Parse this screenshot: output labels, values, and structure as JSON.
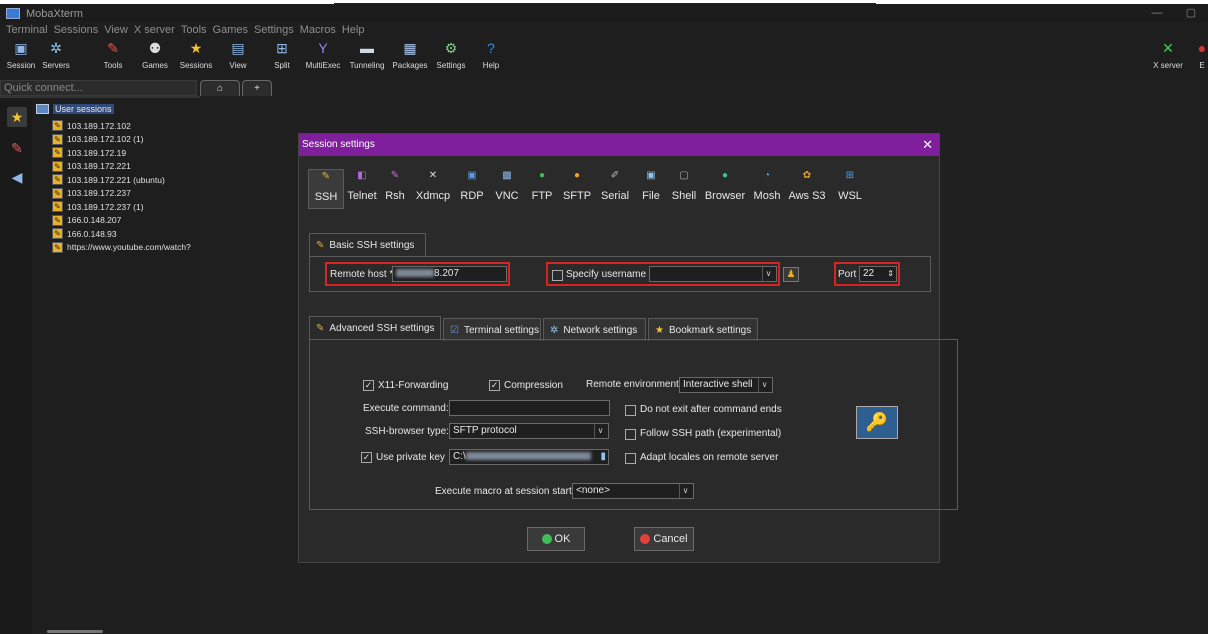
{
  "app": {
    "title": "MobaXterm",
    "window_buttons": [
      "—",
      "▢"
    ]
  },
  "menu": [
    "Terminal",
    "Sessions",
    "View",
    "X server",
    "Tools",
    "Games",
    "Settings",
    "Macros",
    "Help"
  ],
  "toolbar": {
    "items": [
      {
        "label": "Session",
        "icon": "session-icon",
        "glyph": "▣",
        "color": "#8fb7e8"
      },
      {
        "label": "Servers",
        "icon": "servers-icon",
        "glyph": "✲",
        "color": "#8fc4f0"
      },
      {
        "label": "Tools",
        "icon": "tools-icon",
        "glyph": "✎",
        "color": "#e05555"
      },
      {
        "label": "Games",
        "icon": "games-icon",
        "glyph": "⚉",
        "color": "#dddddd"
      },
      {
        "label": "Sessions",
        "icon": "star-icon",
        "glyph": "★",
        "color": "#f4c430"
      },
      {
        "label": "View",
        "icon": "view-icon",
        "glyph": "▤",
        "color": "#8fb7e8"
      },
      {
        "label": "Split",
        "icon": "split-icon",
        "glyph": "⊞",
        "color": "#8fb7e8"
      },
      {
        "label": "MultiExec",
        "icon": "multiexec-icon",
        "glyph": "Y",
        "color": "#8f88f0"
      },
      {
        "label": "Tunneling",
        "icon": "tunneling-icon",
        "glyph": "▬",
        "color": "#cfd8e8"
      },
      {
        "label": "Packages",
        "icon": "packages-icon",
        "glyph": "▦",
        "color": "#aac4ee"
      },
      {
        "label": "Settings",
        "icon": "settings-icon",
        "glyph": "⚙",
        "color": "#7fd18a"
      },
      {
        "label": "Help",
        "icon": "help-icon",
        "glyph": "?",
        "color": "#2f8de4"
      }
    ],
    "xserver": {
      "label": "X server",
      "icon": "x-server-icon",
      "glyph": "✕",
      "color": "#3fcf5a"
    },
    "exit": {
      "label": "E",
      "icon": "exit-icon",
      "glyph": "●",
      "color": "#d93333"
    }
  },
  "quick_connect": {
    "placeholder": "Quick connect..."
  },
  "tabs": {
    "home_glyph": "⌂",
    "new_tab_glyph": "+"
  },
  "sidebar": {
    "root_label": "User sessions",
    "side_icons": [
      {
        "name": "favorites-icon",
        "glyph": "★",
        "color": "#f4c430"
      },
      {
        "name": "tools-icon",
        "glyph": "✎",
        "color": "#d06060"
      },
      {
        "name": "macros-icon",
        "glyph": "◀",
        "color": "#8fb7e8"
      }
    ],
    "sessions": [
      "103.189.172.102",
      "103.189.172.102 (1)",
      "103.189.172.19",
      "103.189.172.221",
      "103.189.172.221 (ubuntu)",
      "103.189.172.237",
      "103.189.172.237 (1)",
      "166.0.148.207",
      "166.0.148.93",
      "https://www.youtube.com/watch?"
    ]
  },
  "dialog": {
    "title": "Session settings",
    "close_glyph": "✕",
    "protocols": [
      {
        "label": "SSH",
        "icon": "ssh-icon",
        "glyph": "✎",
        "color": "#d6b33a"
      },
      {
        "label": "Telnet",
        "icon": "telnet-icon",
        "glyph": "◧",
        "color": "#b06ad8"
      },
      {
        "label": "Rsh",
        "icon": "rsh-icon",
        "glyph": "✎",
        "color": "#c86ad8"
      },
      {
        "label": "Xdmcp",
        "icon": "xdmcp-icon",
        "glyph": "✕",
        "color": "#cfd8e8"
      },
      {
        "label": "RDP",
        "icon": "rdp-icon",
        "glyph": "▣",
        "color": "#5a9de8"
      },
      {
        "label": "VNC",
        "icon": "vnc-icon",
        "glyph": "▩",
        "color": "#8fb7e8"
      },
      {
        "label": "FTP",
        "icon": "ftp-icon",
        "glyph": "●",
        "color": "#3fbf5a"
      },
      {
        "label": "SFTP",
        "icon": "sftp-icon",
        "glyph": "●",
        "color": "#f2a22a"
      },
      {
        "label": "Serial",
        "icon": "serial-icon",
        "glyph": "✐",
        "color": "#bbbbbb"
      },
      {
        "label": "File",
        "icon": "file-icon",
        "glyph": "▣",
        "color": "#8fc4f0"
      },
      {
        "label": "Shell",
        "icon": "shell-icon",
        "glyph": "▢",
        "color": "#aaaaaa"
      },
      {
        "label": "Browser",
        "icon": "browser-icon",
        "glyph": "●",
        "color": "#3fbfa0"
      },
      {
        "label": "Mosh",
        "icon": "mosh-icon",
        "glyph": "◔",
        "color": "#5fa8e8"
      },
      {
        "label": "Aws S3",
        "icon": "aws-s3-icon",
        "glyph": "✿",
        "color": "#e8a228"
      },
      {
        "label": "WSL",
        "icon": "wsl-icon",
        "glyph": "⊞",
        "color": "#5a9de8"
      }
    ],
    "basic_tab": "Basic SSH settings",
    "remote_host_label": "Remote host *",
    "remote_host_value": "8.207",
    "specify_username_label": "Specify username",
    "username_value": "",
    "port_label": "Port",
    "port_value": "22",
    "adv_tabs": [
      {
        "label": "Advanced SSH settings",
        "icon": "advanced-ssh-icon",
        "glyph": "✎",
        "color": "#d6b33a"
      },
      {
        "label": "Terminal settings",
        "icon": "terminal-settings-icon",
        "glyph": "☑",
        "color": "#5a9de8"
      },
      {
        "label": "Network settings",
        "icon": "network-settings-icon",
        "glyph": "✲",
        "color": "#8fc4f0"
      },
      {
        "label": "Bookmark settings",
        "icon": "bookmark-star-icon",
        "glyph": "★",
        "color": "#f4c430"
      }
    ],
    "x11_label": "X11-Forwarding",
    "compression_label": "Compression",
    "remote_env_label": "Remote environment:",
    "remote_env_value": "Interactive shell",
    "exec_cmd_label": "Execute command:",
    "exec_cmd_value": "",
    "do_not_exit_label": "Do not exit after command ends",
    "browser_type_label": "SSH-browser type:",
    "browser_type_value": "SFTP protocol",
    "follow_path_label": "Follow SSH path (experimental)",
    "private_key_label": "Use private key",
    "private_key_value": "C:\\",
    "adapt_locales_label": "Adapt locales on remote server",
    "macro_label": "Execute macro at session start:",
    "macro_value": "<none>",
    "ok_label": "OK",
    "cancel_label": "Cancel",
    "ok_color": "#3fbf5a",
    "cancel_color": "#e0413a",
    "accent": "#7f1f9b",
    "highlight": "#d62323"
  }
}
